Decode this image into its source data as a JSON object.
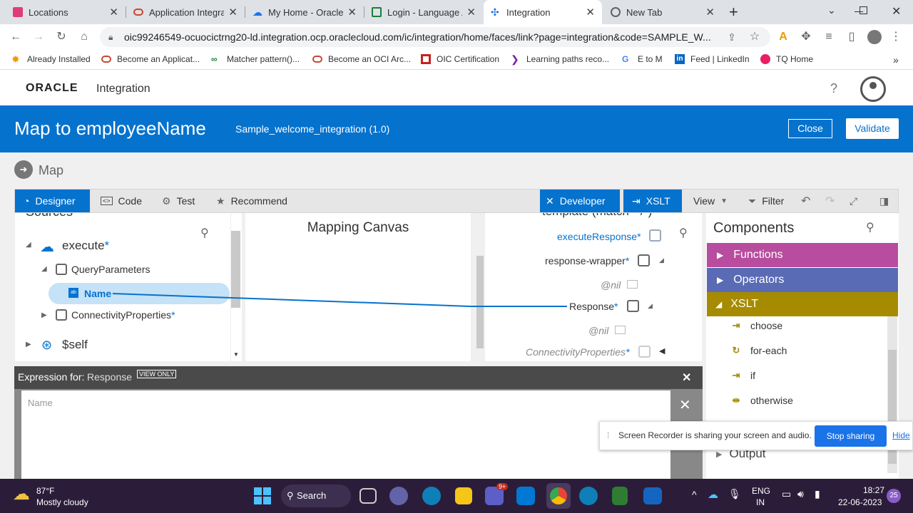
{
  "tabs": [
    {
      "label": "Locations",
      "fav": "#e23b7a"
    },
    {
      "label": "Application Integra",
      "fav": "#c74634"
    },
    {
      "label": "My Home - Oracle",
      "fav": "#1a73e8"
    },
    {
      "label": "Login - Language A",
      "fav": "#188038"
    },
    {
      "label": "Integration",
      "fav": "#1a73e8"
    },
    {
      "label": "New Tab",
      "fav": "#5f6368"
    }
  ],
  "new_tab_symbol": "+",
  "address": {
    "url": "oic99246549-ocuocictrng20-ld.integration.ocp.oraclecloud.com/ic/integration/home/faces/link?page=integration&code=SAMPLE_W..."
  },
  "bookmarks": [
    {
      "label": "Already Installed",
      "color": "#f29900"
    },
    {
      "label": "Become an Applicat...",
      "color": "#c74634"
    },
    {
      "label": "Matcher pattern()...",
      "color": "#188038"
    },
    {
      "label": "Become an OCI Arc...",
      "color": "#c74634"
    },
    {
      "label": "OIC Certification",
      "color": "#c5221f"
    },
    {
      "label": "Learning paths reco...",
      "color": "#7b1fa2"
    },
    {
      "label": "E to M",
      "color": "#4285f4"
    },
    {
      "label": "Feed | LinkedIn",
      "color": "#0a66c2"
    },
    {
      "label": "TQ Home",
      "color": "#e91e63"
    }
  ],
  "brand": {
    "oracle": "ORACLE",
    "product": "Integration"
  },
  "header": {
    "help": "?"
  },
  "bluebar": {
    "title": "Map to employeeName",
    "subtitle": "Sample_welcome_integration (1.0)",
    "close_label": "Close",
    "validate_label": "Validate"
  },
  "map_label": "Map",
  "toolbar": {
    "designer": "Designer",
    "code": "Code",
    "test": "Test",
    "recommend": "Recommend",
    "developer": "Developer",
    "xslt": "XSLT",
    "view": "View",
    "filter": "Filter"
  },
  "sources": {
    "header": "Sources",
    "execute": "execute",
    "query_parameters": "QueryParameters",
    "name": "Name",
    "connectivity": "ConnectivityProperties",
    "self": "$self",
    "asterisk": "*"
  },
  "canvas": {
    "title": "Mapping Canvas"
  },
  "target": {
    "header": "template (match=\"/\")",
    "execute_response": "executeResponse",
    "response_wrapper": "response-wrapper",
    "nil1": "@nil",
    "response": "Response",
    "nil2": "@nil",
    "connectivity": "ConnectivityProperties"
  },
  "components": {
    "title": "Components",
    "functions": "Functions",
    "operators": "Operators",
    "xslt": "XSLT",
    "items": [
      "choose",
      "for-each",
      "if",
      "otherwise"
    ],
    "output": "Output",
    "colors": {
      "functions": "#b84c9e",
      "operators": "#5a6bb5",
      "xslt": "#a68b00"
    }
  },
  "expression": {
    "label": "Expression for:",
    "target": "Response",
    "badge": "VIEW ONLY",
    "placeholder": "Name"
  },
  "share_bar": {
    "message": "Screen Recorder is sharing your screen and audio.",
    "stop": "Stop sharing",
    "hide": "Hide"
  },
  "taskbar": {
    "temp": "87°F",
    "weather": "Mostly cloudy",
    "search": "Search",
    "teams_badge": "9+",
    "lang1": "ENG",
    "lang2": "IN",
    "time": "18:27",
    "date": "22-06-2023",
    "notif": "25"
  }
}
